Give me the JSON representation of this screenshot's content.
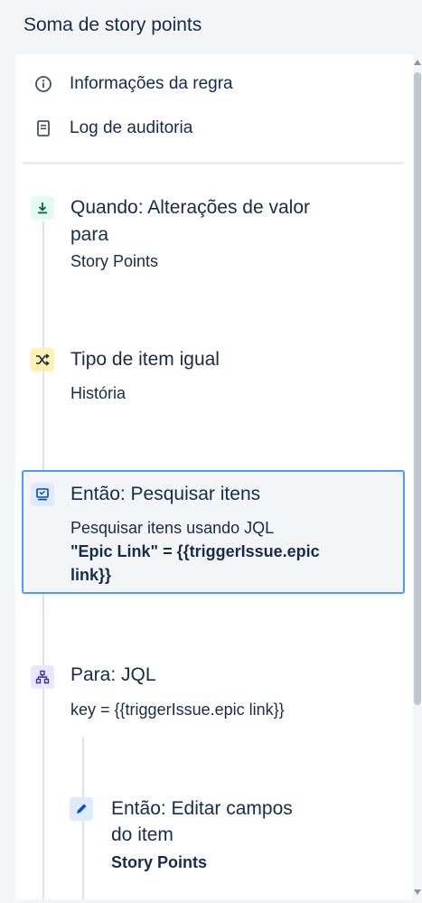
{
  "header": {
    "title": "Soma de story points"
  },
  "menu": [
    {
      "label": "Informações da regra",
      "icon": "info-icon"
    },
    {
      "label": "Log de auditoria",
      "icon": "document-icon"
    }
  ],
  "steps": {
    "trigger": {
      "title_line1": "Quando: Alterações de valor",
      "title_line2": "para",
      "sub": "Story Points",
      "icon": "download-icon",
      "color": "#e3fcef"
    },
    "condition": {
      "title": "Tipo de item igual",
      "sub": "História",
      "icon": "shuffle-icon",
      "color": "#fff0b3"
    },
    "search": {
      "title": "Então: Pesquisar itens",
      "sub": "Pesquisar itens usando JQL",
      "bold_line1": "\"Epic Link\" = {{triggerIssue.epic",
      "bold_line2": "link}}",
      "icon": "monitor-icon",
      "color": "#deebff"
    },
    "branch": {
      "title": "Para: JQL",
      "sub": "key = {{triggerIssue.epic link}}",
      "icon": "hierarchy-icon",
      "color": "#eae6ff"
    },
    "edit": {
      "title_line1": "Então: Editar campos",
      "title_line2": "do item",
      "bold": "Story Points",
      "icon": "pencil-icon",
      "color": "#deebff"
    }
  },
  "colors": {
    "accent": "#4c9aff",
    "text": "#172b4d"
  }
}
